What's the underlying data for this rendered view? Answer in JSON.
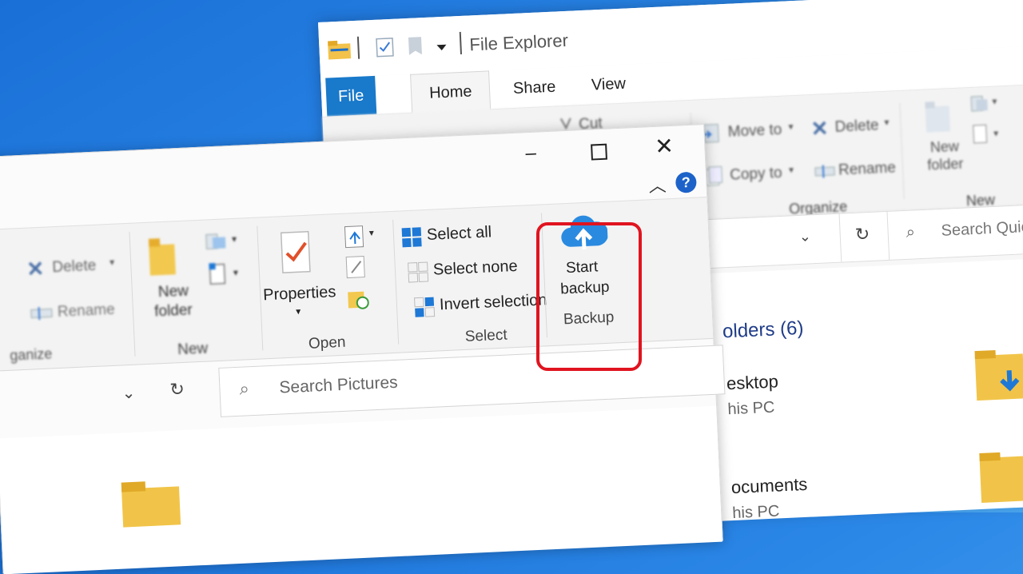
{
  "back_window": {
    "title": "File Explorer",
    "tabs": [
      "File",
      "Home",
      "Share",
      "View"
    ],
    "ribbon": {
      "cut_label": "Cut",
      "move_to_label": "Move to",
      "copy_to_label": "Copy to",
      "delete_label": "Delete",
      "rename_label": "Rename",
      "organize_label": "Organize",
      "new_folder_label": "New folder",
      "new_label": "New"
    },
    "search_placeholder": "Search Quic",
    "folders_heading": "olders (6)",
    "items": [
      {
        "name": "esktop",
        "sub": "his PC"
      },
      {
        "name": "ocuments",
        "sub": "his PC"
      }
    ]
  },
  "front_window": {
    "ribbon": {
      "delete_label": "Delete",
      "rename_label": "Rename",
      "organize_label": "ganize",
      "new_folder_label_1": "New",
      "new_folder_label_2": "folder",
      "new_label": "New",
      "properties_label": "Properties",
      "open_label": "Open",
      "select_all_label": "Select all",
      "select_none_label": "Select none",
      "invert_selection_label": "Invert selection",
      "select_label": "Select",
      "start_backup_label_1": "Start",
      "start_backup_label_2": "backup",
      "backup_label": "Backup"
    },
    "search_placeholder": "Search Pictures"
  },
  "colors": {
    "file_tab": "#1979ca",
    "highlight": "#e0141f",
    "cloud": "#2a8ae0",
    "help": "#1d62c9"
  }
}
